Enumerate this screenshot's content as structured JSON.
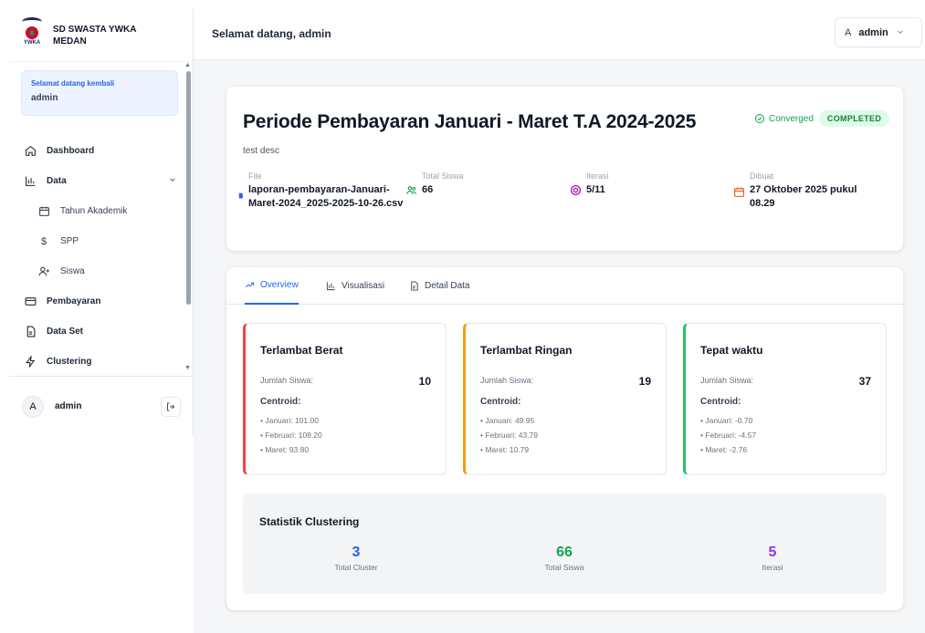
{
  "brand": {
    "name_line1": "SD SWASTA YWKA",
    "name_line2": "MEDAN",
    "logo_text": "YWKA"
  },
  "sidebar": {
    "welcome_small": "Selamat datang kembali",
    "welcome_user": "admin",
    "items": [
      {
        "label": "Dashboard"
      },
      {
        "label": "Data"
      },
      {
        "label": "Tahun Akademik"
      },
      {
        "label": "SPP"
      },
      {
        "label": "Siswa"
      },
      {
        "label": "Pembayaran"
      },
      {
        "label": "Data Set"
      },
      {
        "label": "Clustering"
      }
    ],
    "footer_avatar": "A",
    "footer_user": "admin"
  },
  "header": {
    "title": "Selamat datang, admin",
    "user_avatar": "A",
    "user_name": "admin"
  },
  "period": {
    "title": "Periode Pembayaran Januari - Maret T.A 2024-2025",
    "converged_label": "Converged",
    "status": "COMPLETED",
    "description": "test desc",
    "file_label": "File",
    "file_value": "laporan-pembayaran-Januari-Maret-2024_2025-2025-10-26.csv",
    "total_siswa_label": "Total Siswa",
    "total_siswa_value": "66",
    "iterasi_label": "Iterasi",
    "iterasi_value": "5/11",
    "dibuat_label": "Dibuat",
    "dibuat_value": "27 Oktober 2025 pukul 08.29"
  },
  "tabs": [
    {
      "label": "Overview"
    },
    {
      "label": "Visualisasi"
    },
    {
      "label": "Detail Data"
    }
  ],
  "clusters": [
    {
      "title": "Terlambat Berat",
      "count_label": "Jumlah Siswa:",
      "count": "10",
      "centroid_label": "Centroid:",
      "color": "#ef4444",
      "centroids": [
        "• Januari: 101.00",
        "• Februari: 108.20",
        "• Maret: 93.80"
      ]
    },
    {
      "title": "Terlambat Ringan",
      "count_label": "Jumlah Siswa:",
      "count": "19",
      "centroid_label": "Centroid:",
      "color": "#f59e0b",
      "centroids": [
        "• Januari: 49.95",
        "• Februari: 43.79",
        "• Maret: 10.79"
      ]
    },
    {
      "title": "Tepat waktu",
      "count_label": "Jumlah Siswa:",
      "count": "37",
      "centroid_label": "Centroid:",
      "color": "#22c55e",
      "centroids": [
        "• Januari: -0.70",
        "• Februari: -4.57",
        "• Maret: -2.76"
      ]
    }
  ],
  "stats": {
    "title": "Statistik Clustering",
    "items": [
      {
        "value": "3",
        "label": "Total Cluster",
        "color": "#2563eb"
      },
      {
        "value": "66",
        "label": "Total Siswa",
        "color": "#16a34a"
      },
      {
        "value": "5",
        "label": "Iterasi",
        "color": "#9333ea"
      }
    ]
  }
}
